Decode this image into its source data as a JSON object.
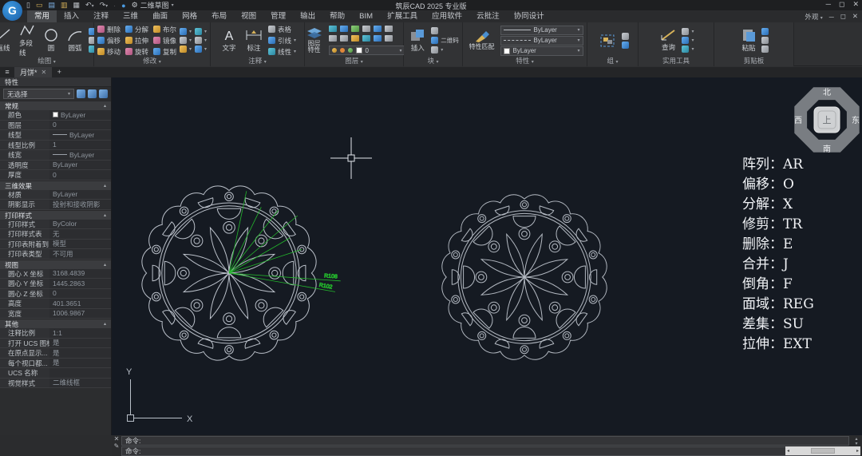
{
  "titlebar": {
    "app_title": "筑辰CAD 2025 专业版",
    "workspace": "二维草图"
  },
  "menu_tabs": [
    "常用",
    "插入",
    "注释",
    "三维",
    "曲面",
    "网格",
    "布局",
    "视图",
    "管理",
    "输出",
    "帮助",
    "BIM",
    "扩展工具",
    "应用软件",
    "云批注",
    "协同设计"
  ],
  "active_tab": "常用",
  "tabrow_right": {
    "appearance": "外观"
  },
  "ribbon": {
    "draw": {
      "label": "绘图",
      "tools": [
        "直线",
        "多段线",
        "圆",
        "圆弧"
      ]
    },
    "modify": {
      "label": "修改",
      "grid": [
        [
          "删除",
          "分解",
          "布尔"
        ],
        [
          "偏移",
          "拉伸",
          "镜像"
        ],
        [
          "移动",
          "旋转",
          "复制"
        ]
      ]
    },
    "annotate": {
      "label": "注释",
      "text_tool": "文字",
      "dim_tool": "标注",
      "small": [
        "表格",
        "引线",
        "线性"
      ]
    },
    "layers": {
      "label": "图层",
      "main_tool": "图层特性",
      "current_layer": "0"
    },
    "block": {
      "label": "块",
      "insert_tool": "插入",
      "qr_tool": "二维码"
    },
    "props": {
      "label": "特性",
      "match_tool": "特性匹配",
      "combo1": "ByLayer",
      "combo2": "ByLayer",
      "combo3": "ByLayer"
    },
    "group": {
      "label": "组"
    },
    "utils": {
      "label": "实用工具",
      "query_tool": "查询"
    },
    "clipboard": {
      "label": "剪贴板",
      "paste_tool": "粘贴"
    }
  },
  "doc_tab": {
    "name": "月饼*"
  },
  "properties": {
    "title": "特性",
    "selector": "无选择",
    "sections": [
      {
        "title": "常规",
        "rows": [
          {
            "label": "颜色",
            "value": "ByLayer",
            "kind": "color"
          },
          {
            "label": "图层",
            "value": "0"
          },
          {
            "label": "线型",
            "value": "ByLayer",
            "kind": "line"
          },
          {
            "label": "线型比例",
            "value": "1"
          },
          {
            "label": "线宽",
            "value": "ByLayer",
            "kind": "line"
          },
          {
            "label": "透明度",
            "value": "ByLayer"
          },
          {
            "label": "厚度",
            "value": "0"
          }
        ]
      },
      {
        "title": "三维效果",
        "rows": [
          {
            "label": "材质",
            "value": "ByLayer"
          },
          {
            "label": "阴影显示",
            "value": "投射和接收阴影"
          }
        ]
      },
      {
        "title": "打印样式",
        "rows": [
          {
            "label": "打印样式",
            "value": "ByColor"
          },
          {
            "label": "打印样式表",
            "value": "无"
          },
          {
            "label": "打印表附着到",
            "value": "模型"
          },
          {
            "label": "打印表类型",
            "value": "不可用"
          }
        ]
      },
      {
        "title": "视图",
        "rows": [
          {
            "label": "圆心 X 坐标",
            "value": "3168.4839"
          },
          {
            "label": "圆心 Y 坐标",
            "value": "1445.2863"
          },
          {
            "label": "圆心 Z 坐标",
            "value": "0"
          },
          {
            "label": "高度",
            "value": "401.3651"
          },
          {
            "label": "宽度",
            "value": "1006.9867"
          }
        ]
      },
      {
        "title": "其他",
        "rows": [
          {
            "label": "注释比例",
            "value": "1:1"
          },
          {
            "label": "打开 UCS 图标",
            "value": "是"
          },
          {
            "label": "在原点显示...",
            "value": "是"
          },
          {
            "label": "每个视口都...",
            "value": "是"
          },
          {
            "label": "UCS 名称",
            "value": ""
          },
          {
            "label": "视觉样式",
            "value": "二维线框"
          }
        ]
      }
    ]
  },
  "canvas": {
    "command_list": [
      {
        "label": "阵列",
        "key": "AR"
      },
      {
        "label": "偏移",
        "key": "O"
      },
      {
        "label": "分解",
        "key": "X"
      },
      {
        "label": "修剪",
        "key": "TR"
      },
      {
        "label": "删除",
        "key": "E"
      },
      {
        "label": "合并",
        "key": "J"
      },
      {
        "label": "倒角",
        "key": "F"
      },
      {
        "label": "面域",
        "key": "REG"
      },
      {
        "label": "差集",
        "key": "SU"
      },
      {
        "label": "拉伸",
        "key": "EXT"
      }
    ],
    "dimension_labels": [
      "R108",
      "R102"
    ],
    "viewcube": {
      "north": "北",
      "south": "南",
      "east": "东",
      "west": "西",
      "top": "上"
    },
    "ucs": {
      "x": "X",
      "y": "Y"
    },
    "colors": {
      "line": "#c9cfd8",
      "dimension": "#23b82c",
      "background": "#151a22"
    }
  },
  "commandline": {
    "prompt1": "命令:",
    "prompt2": "命令:"
  },
  "glyphs": {
    "hamburger": "≡",
    "plus": "+",
    "close": "✕",
    "minimize": "─",
    "maximize": "◻",
    "dropdown": "▾",
    "collapse": "▴",
    "undo": "↶",
    "redo": "↷",
    "gear": "⚙",
    "scroll_left": "◂",
    "scroll_right": "▸"
  }
}
